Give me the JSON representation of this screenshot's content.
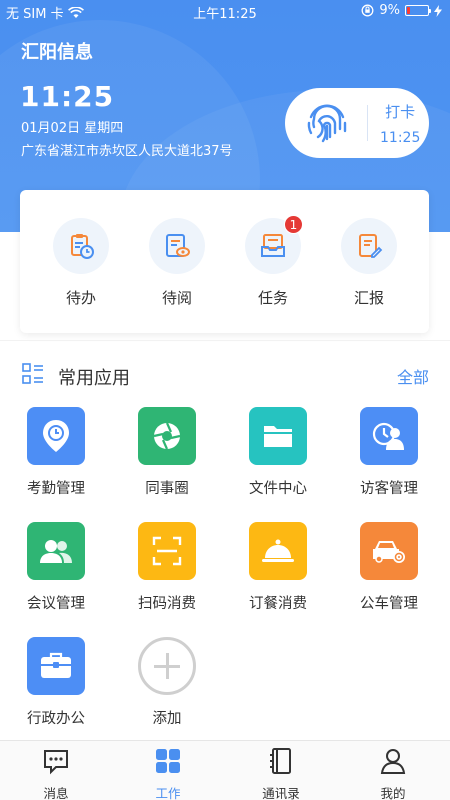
{
  "status_bar": {
    "carrier": "无 SIM 卡",
    "time": "上午11:25",
    "battery": "9%"
  },
  "header": {
    "company": "汇阳信息",
    "clock": "11:25",
    "date": "01月02日 星期四",
    "address": "广东省湛江市赤坎区人民大道北37号",
    "punch_label": "打卡",
    "punch_time": "11:25"
  },
  "quick": [
    {
      "label": "待办"
    },
    {
      "label": "待阅"
    },
    {
      "label": "任务",
      "badge": "1"
    },
    {
      "label": "汇报"
    }
  ],
  "section": {
    "title": "常用应用",
    "all": "全部"
  },
  "apps": [
    {
      "label": "考勤管理",
      "color": "#4d8ef5",
      "icon": "location-clock-icon"
    },
    {
      "label": "同事圈",
      "color": "#2fb574",
      "icon": "shutter-icon"
    },
    {
      "label": "文件中心",
      "color": "#26c3c0",
      "icon": "folder-icon"
    },
    {
      "label": "访客管理",
      "color": "#4d8ef5",
      "icon": "visitor-icon"
    },
    {
      "label": "会议管理",
      "color": "#2fb574",
      "icon": "people-icon"
    },
    {
      "label": "扫码消费",
      "color": "#fdb813",
      "icon": "scan-icon"
    },
    {
      "label": "订餐消费",
      "color": "#fdb813",
      "icon": "cloche-icon"
    },
    {
      "label": "公车管理",
      "color": "#f5883a",
      "icon": "car-icon"
    },
    {
      "label": "行政办公",
      "color": "#4d8ef5",
      "icon": "briefcase-icon"
    },
    {
      "label": "添加",
      "color": "#cfcfcf",
      "icon": "add-icon"
    }
  ],
  "tabs": [
    {
      "label": "消息"
    },
    {
      "label": "工作"
    },
    {
      "label": "通讯录"
    },
    {
      "label": "我的"
    }
  ]
}
